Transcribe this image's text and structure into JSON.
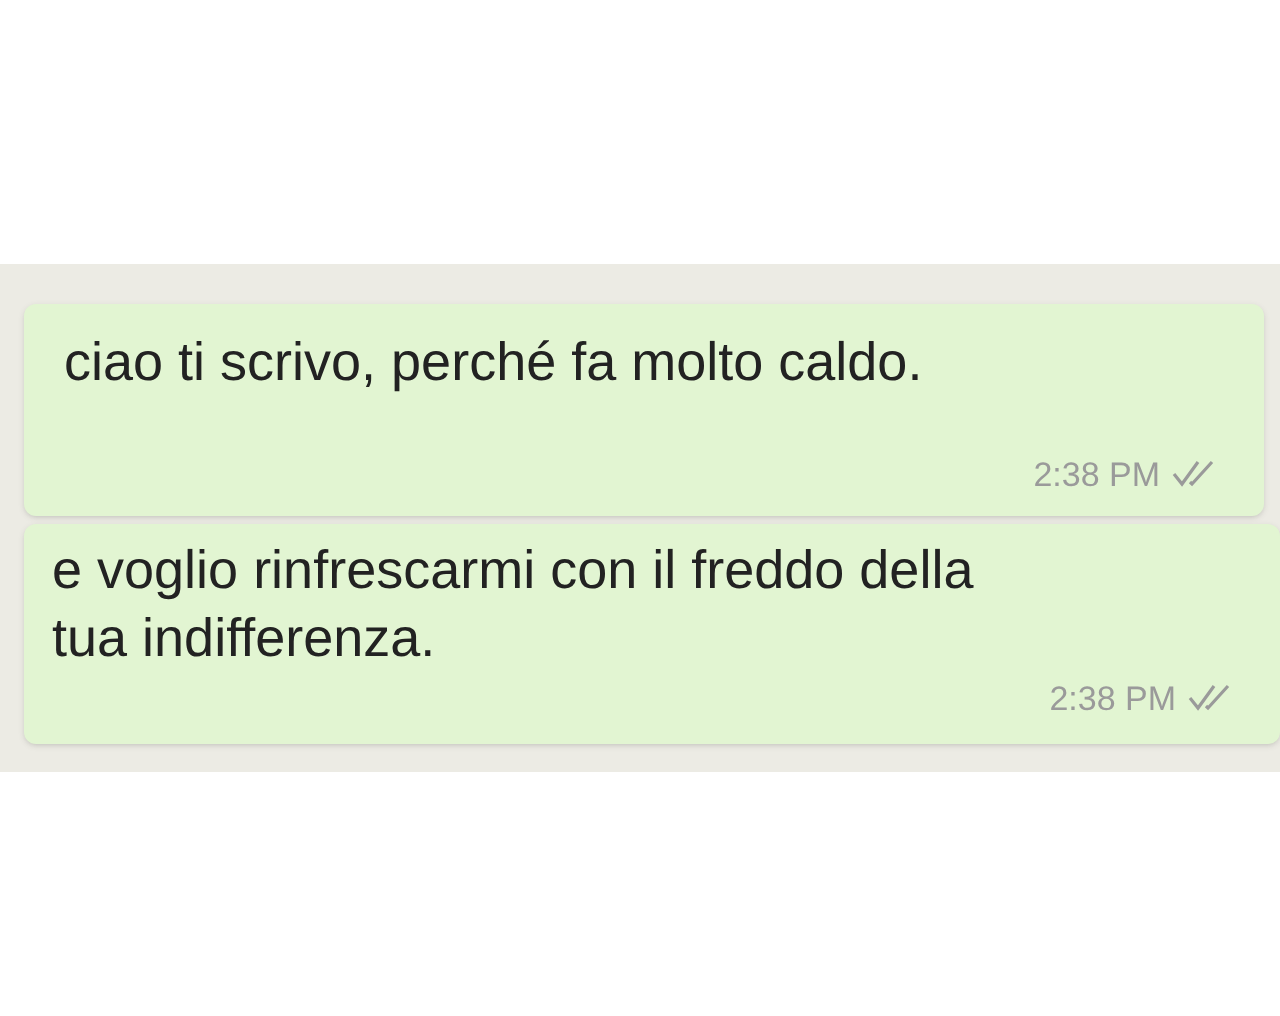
{
  "messages": [
    {
      "text": "ciao ti scrivo, perché fa molto caldo.",
      "time": "2:38 PM",
      "read": true
    },
    {
      "text": "e voglio rinfrescarmi con il freddo della tua indifferenza.",
      "time": "2:38 PM",
      "read": true
    }
  ]
}
